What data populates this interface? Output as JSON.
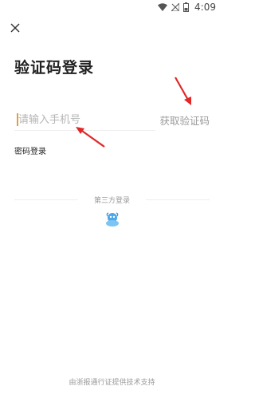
{
  "status_bar": {
    "time": "4:09",
    "icons": [
      "wifi-icon",
      "signal-icon",
      "battery-icon"
    ]
  },
  "header": {
    "close_icon": "close-icon",
    "title": "验证码登录"
  },
  "phone_login": {
    "phone_placeholder": "请输入手机号",
    "phone_value": "",
    "get_code_label": "获取验证码"
  },
  "password_login_label": "密码登录",
  "third_party": {
    "label": "第三方登录",
    "icon": "zhebaotong-icon"
  },
  "footer": {
    "text": "由浙报通行证提供技术支持"
  },
  "annotation_arrows": {
    "color": "#e0282a"
  }
}
